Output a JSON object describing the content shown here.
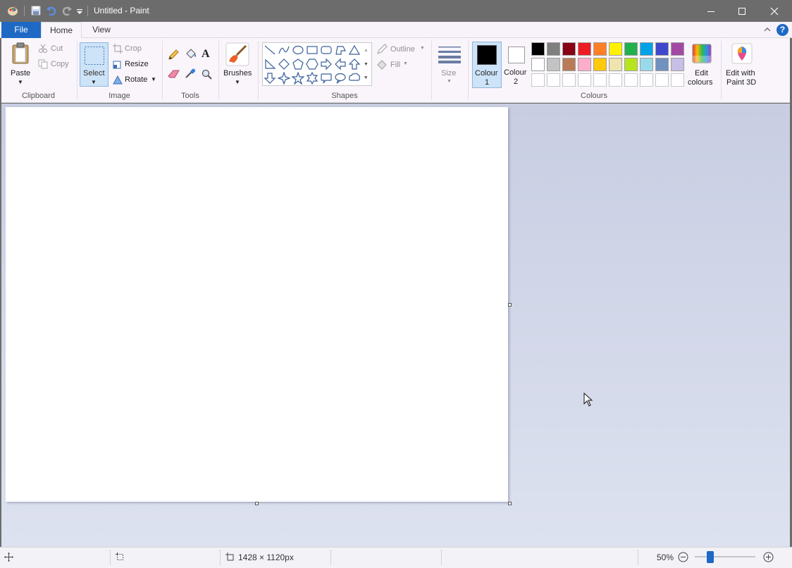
{
  "window": {
    "title": "Untitled - Paint"
  },
  "tabs": {
    "file": "File",
    "home": "Home",
    "view": "View"
  },
  "help_label": "?",
  "ribbon": {
    "clipboard": {
      "paste": "Paste",
      "cut": "Cut",
      "copy": "Copy",
      "label": "Clipboard"
    },
    "image": {
      "select": "Select",
      "crop": "Crop",
      "resize": "Resize",
      "rotate": "Rotate",
      "label": "Image"
    },
    "tools": {
      "label": "Tools"
    },
    "brushes": {
      "label": "Brushes"
    },
    "shapes": {
      "outline": "Outline",
      "fill": "Fill",
      "label": "Shapes"
    },
    "size": {
      "label": "Size"
    },
    "colours": {
      "colour1_line1": "Colour",
      "colour1_line2": "1",
      "colour2_line1": "Colour",
      "colour2_line2": "2",
      "edit_line1": "Edit",
      "edit_line2": "colours",
      "label": "Colours",
      "colour1_value": "#000000",
      "colour2_value": "#ffffff",
      "palette_row1": [
        "#000000",
        "#7f7f7f",
        "#880015",
        "#ed1c24",
        "#ff7f27",
        "#fff200",
        "#22b14c",
        "#00a2e8",
        "#3f48cc",
        "#a349a4"
      ],
      "palette_row2": [
        "#ffffff",
        "#c3c3c3",
        "#b97a57",
        "#ffaec9",
        "#ffc90e",
        "#efe4b0",
        "#b5e61d",
        "#99d9ea",
        "#7092be",
        "#c8bfe7"
      ]
    },
    "paint3d": {
      "line1": "Edit with",
      "line2": "Paint 3D"
    }
  },
  "status": {
    "canvas_size": "1428 × 1120px",
    "zoom": "50%",
    "zoom_fraction": 0.25
  }
}
